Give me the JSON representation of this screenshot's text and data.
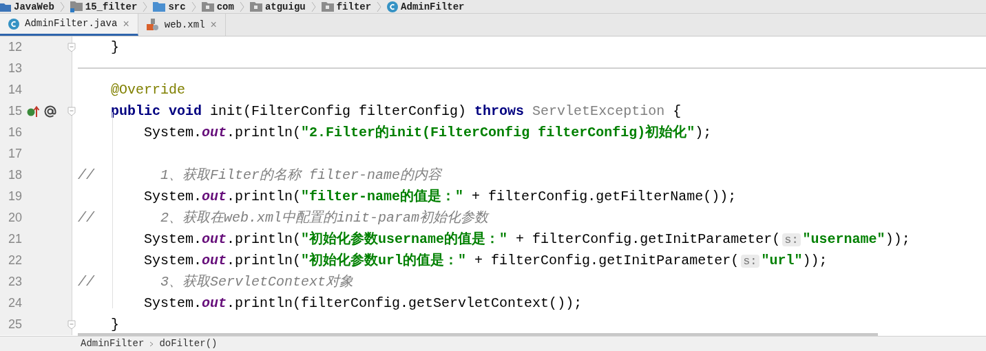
{
  "breadcrumb": [
    {
      "label": "JavaWeb",
      "kind": "project"
    },
    {
      "label": "15_filter",
      "kind": "module"
    },
    {
      "label": "src",
      "kind": "source"
    },
    {
      "label": "com",
      "kind": "package"
    },
    {
      "label": "atguigu",
      "kind": "package"
    },
    {
      "label": "filter",
      "kind": "package"
    },
    {
      "label": "AdminFilter",
      "kind": "class"
    }
  ],
  "tabs": [
    {
      "label": "AdminFilter.java",
      "kind": "class",
      "selected": true,
      "close": "×"
    },
    {
      "label": "web.xml",
      "kind": "xml",
      "selected": false,
      "close": "×"
    }
  ],
  "editor": {
    "lines": [
      {
        "number": "12",
        "fold": true,
        "tokens": [
          {
            "kind": "plain",
            "text": "    }"
          }
        ]
      },
      {
        "number": "13"
      },
      {
        "number": "14",
        "tokens": [
          {
            "kind": "annotation",
            "text": "    @Override"
          }
        ]
      },
      {
        "number": "15",
        "fold": true,
        "gutter_icons": true,
        "tokens": [
          {
            "kind": "keyword",
            "text": "    public void "
          },
          {
            "kind": "plain",
            "text": "init(FilterConfig filterConfig) "
          },
          {
            "kind": "keyword",
            "text": "throws "
          },
          {
            "kind": "type",
            "text": "ServletException "
          },
          {
            "kind": "plain",
            "text": "{"
          }
        ]
      },
      {
        "number": "16",
        "tokens": [
          {
            "kind": "plain",
            "text": "        System."
          },
          {
            "kind": "field",
            "text": "out"
          },
          {
            "kind": "plain",
            "text": ".println("
          },
          {
            "kind": "string",
            "text": "\"2.Filter的init(FilterConfig filterConfig)初始化\""
          },
          {
            "kind": "plain",
            "text": ");"
          }
        ]
      },
      {
        "number": "17"
      },
      {
        "number": "18",
        "tokens": [
          {
            "kind": "comment",
            "text": "//        1、获取Filter的名称 filter-name的内容"
          }
        ]
      },
      {
        "number": "19",
        "tokens": [
          {
            "kind": "plain",
            "text": "        System."
          },
          {
            "kind": "field",
            "text": "out"
          },
          {
            "kind": "plain",
            "text": ".println("
          },
          {
            "kind": "string",
            "text": "\"filter-name的值是：\""
          },
          {
            "kind": "plain",
            "text": " + filterConfig.getFilterName());"
          }
        ]
      },
      {
        "number": "20",
        "tokens": [
          {
            "kind": "comment",
            "text": "//        2、获取在web.xml中配置的init-param初始化参数"
          }
        ]
      },
      {
        "number": "21",
        "tokens": [
          {
            "kind": "plain",
            "text": "        System."
          },
          {
            "kind": "field",
            "text": "out"
          },
          {
            "kind": "plain",
            "text": ".println("
          },
          {
            "kind": "string",
            "text": "\"初始化参数username的值是：\""
          },
          {
            "kind": "plain",
            "text": " + filterConfig.getInitParameter("
          },
          {
            "kind": "hint",
            "text": "s:"
          },
          {
            "kind": "string",
            "text": "\"username\""
          },
          {
            "kind": "plain",
            "text": "));"
          }
        ]
      },
      {
        "number": "22",
        "tokens": [
          {
            "kind": "plain",
            "text": "        System."
          },
          {
            "kind": "field",
            "text": "out"
          },
          {
            "kind": "plain",
            "text": ".println("
          },
          {
            "kind": "string",
            "text": "\"初始化参数url的值是：\""
          },
          {
            "kind": "plain",
            "text": " + filterConfig.getInitParameter("
          },
          {
            "kind": "hint",
            "text": "s:"
          },
          {
            "kind": "string",
            "text": "\"url\""
          },
          {
            "kind": "plain",
            "text": "));"
          }
        ]
      },
      {
        "number": "23",
        "tokens": [
          {
            "kind": "comment",
            "text": "//        3、获取ServletContext对象"
          }
        ]
      },
      {
        "number": "24",
        "tokens": [
          {
            "kind": "plain",
            "text": "        System."
          },
          {
            "kind": "field",
            "text": "out"
          },
          {
            "kind": "plain",
            "text": ".println(filterConfig.getServletContext());"
          }
        ]
      },
      {
        "number": "25",
        "fold": true,
        "tokens": [
          {
            "kind": "plain",
            "text": "    }"
          }
        ]
      }
    ]
  },
  "status_breadcrumb": [
    "AdminFilter",
    "doFilter()"
  ]
}
